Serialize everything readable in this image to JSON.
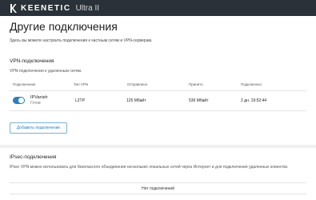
{
  "header": {
    "brand": "KEENETIC",
    "model": "Ultra II",
    "logo_icon": "keenetic-logo-icon",
    "colors": {
      "bar": "#2a3138"
    }
  },
  "page": {
    "title": "Другие подключения",
    "description": "Здесь вы можете настроить подключения к частным сетям и VPN-серверам."
  },
  "vpn": {
    "title": "VPN-подключения",
    "description": "VPN-подключения к удаленным сетям.",
    "columns": {
      "connection": "Подключение",
      "type": "Тип VPN",
      "sent": "Отправлено",
      "received": "Принято",
      "connected": "Подключено"
    },
    "rows": [
      {
        "name": "IPVanish",
        "status": "Готов",
        "type": "L2TP",
        "sent": "125 Мбайт",
        "received": "536 Мбайт",
        "connected": "2 дн. 19:52:44",
        "enabled": true
      }
    ],
    "add_button": "Добавить подключение"
  },
  "ipsec": {
    "title": "IPsec-подключения",
    "description": "IPsec VPN можно использовать для безопасного объединения нескольких локальных сетей через Интернет и для подключения удаленных клиентов.",
    "empty_text": "Нет подключений"
  },
  "colors": {
    "accent": "#2f7fbf"
  }
}
